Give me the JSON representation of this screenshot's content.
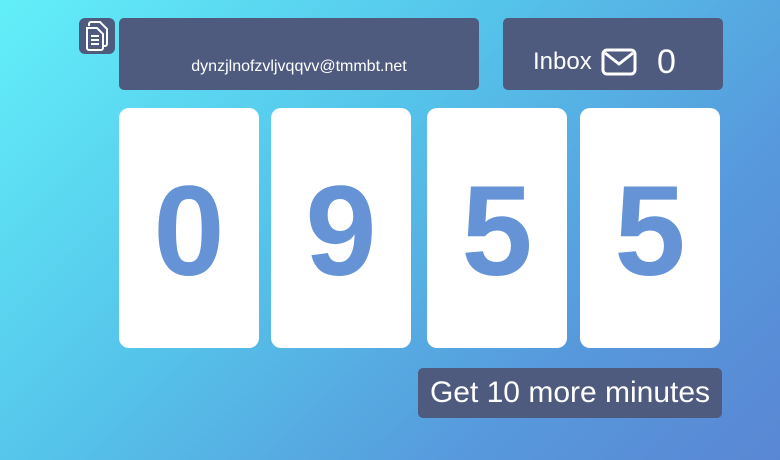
{
  "email": {
    "address": "dynzjlnofzvljvqqvv@tmmbt.net",
    "copy_icon": "copy-icon"
  },
  "inbox": {
    "label": "Inbox",
    "icon": "envelope-icon",
    "count": "0"
  },
  "timer": {
    "digits": [
      "0",
      "9",
      "5",
      "5"
    ]
  },
  "actions": {
    "more_minutes_label": "Get 10 more minutes"
  },
  "colors": {
    "panel": "#4e5a7e",
    "digit": "#6593d5",
    "card": "#ffffff",
    "gradient_start": "#62eff9",
    "gradient_end": "#5a87d3"
  }
}
